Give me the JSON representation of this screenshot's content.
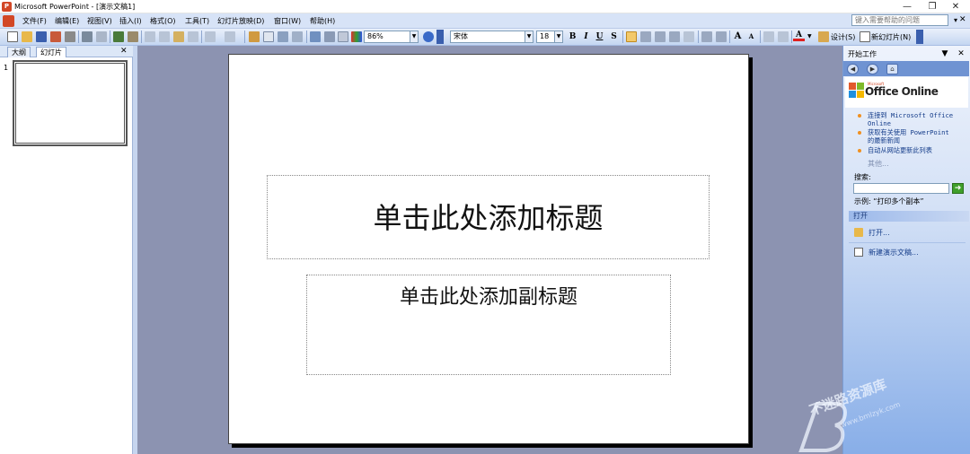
{
  "window": {
    "title": "Microsoft PowerPoint - [演示文稿1]",
    "app_icon_letter": "P",
    "minimize": "—",
    "restore": "❐",
    "close": "✕"
  },
  "menu": {
    "items": [
      "文件(F)",
      "编辑(E)",
      "视图(V)",
      "插入(I)",
      "格式(O)",
      "工具(T)",
      "幻灯片放映(D)",
      "窗口(W)",
      "帮助(H)"
    ],
    "help_placeholder": "键入需要帮助的问题",
    "help_dropdown": "▾",
    "close": "✕"
  },
  "toolbar": {
    "zoom": "86%",
    "font": "宋体",
    "font_size": "18",
    "bold": "B",
    "italic": "I",
    "underline": "U",
    "shadow": "S",
    "increase_font": "A",
    "decrease_font": "A",
    "font_color": "A",
    "design": "设计(S)",
    "new_slide": "新幻灯片(N)"
  },
  "left_pane": {
    "tabs": [
      "大纲",
      "幻灯片"
    ],
    "active_tab": 1,
    "close": "✕",
    "slide_number": "1"
  },
  "slide": {
    "title_placeholder": "单击此处添加标题",
    "subtitle_placeholder": "单击此处添加副标题"
  },
  "task_pane": {
    "title": "开始工作",
    "menu_arrow": "▼",
    "close": "✕",
    "nav": [
      "◀",
      "▶",
      "⌂"
    ],
    "logo_small": "Microsoft",
    "logo_text": "Office Online",
    "links": [
      [
        "连接到 Microsoft Office",
        "Online"
      ],
      [
        "获取有关使用 PowerPoint",
        "的最新新闻"
      ],
      [
        "自动从网站更新此列表"
      ]
    ],
    "more": "其他...",
    "search_label": "搜索:",
    "search_go": "➜",
    "example": "示例: “打印多个副本”",
    "open_section": "打开",
    "open_items": [
      "打开...",
      "新建演示文稿..."
    ]
  },
  "watermark": {
    "text": "不迷路资源库",
    "url": "www.bmlzyk.com"
  },
  "colors": {
    "menubar": "#d7e3f7",
    "editor_bg": "#8c93b1",
    "task_pane_bottom": "#88aee8",
    "accent_link": "#153d8a"
  }
}
